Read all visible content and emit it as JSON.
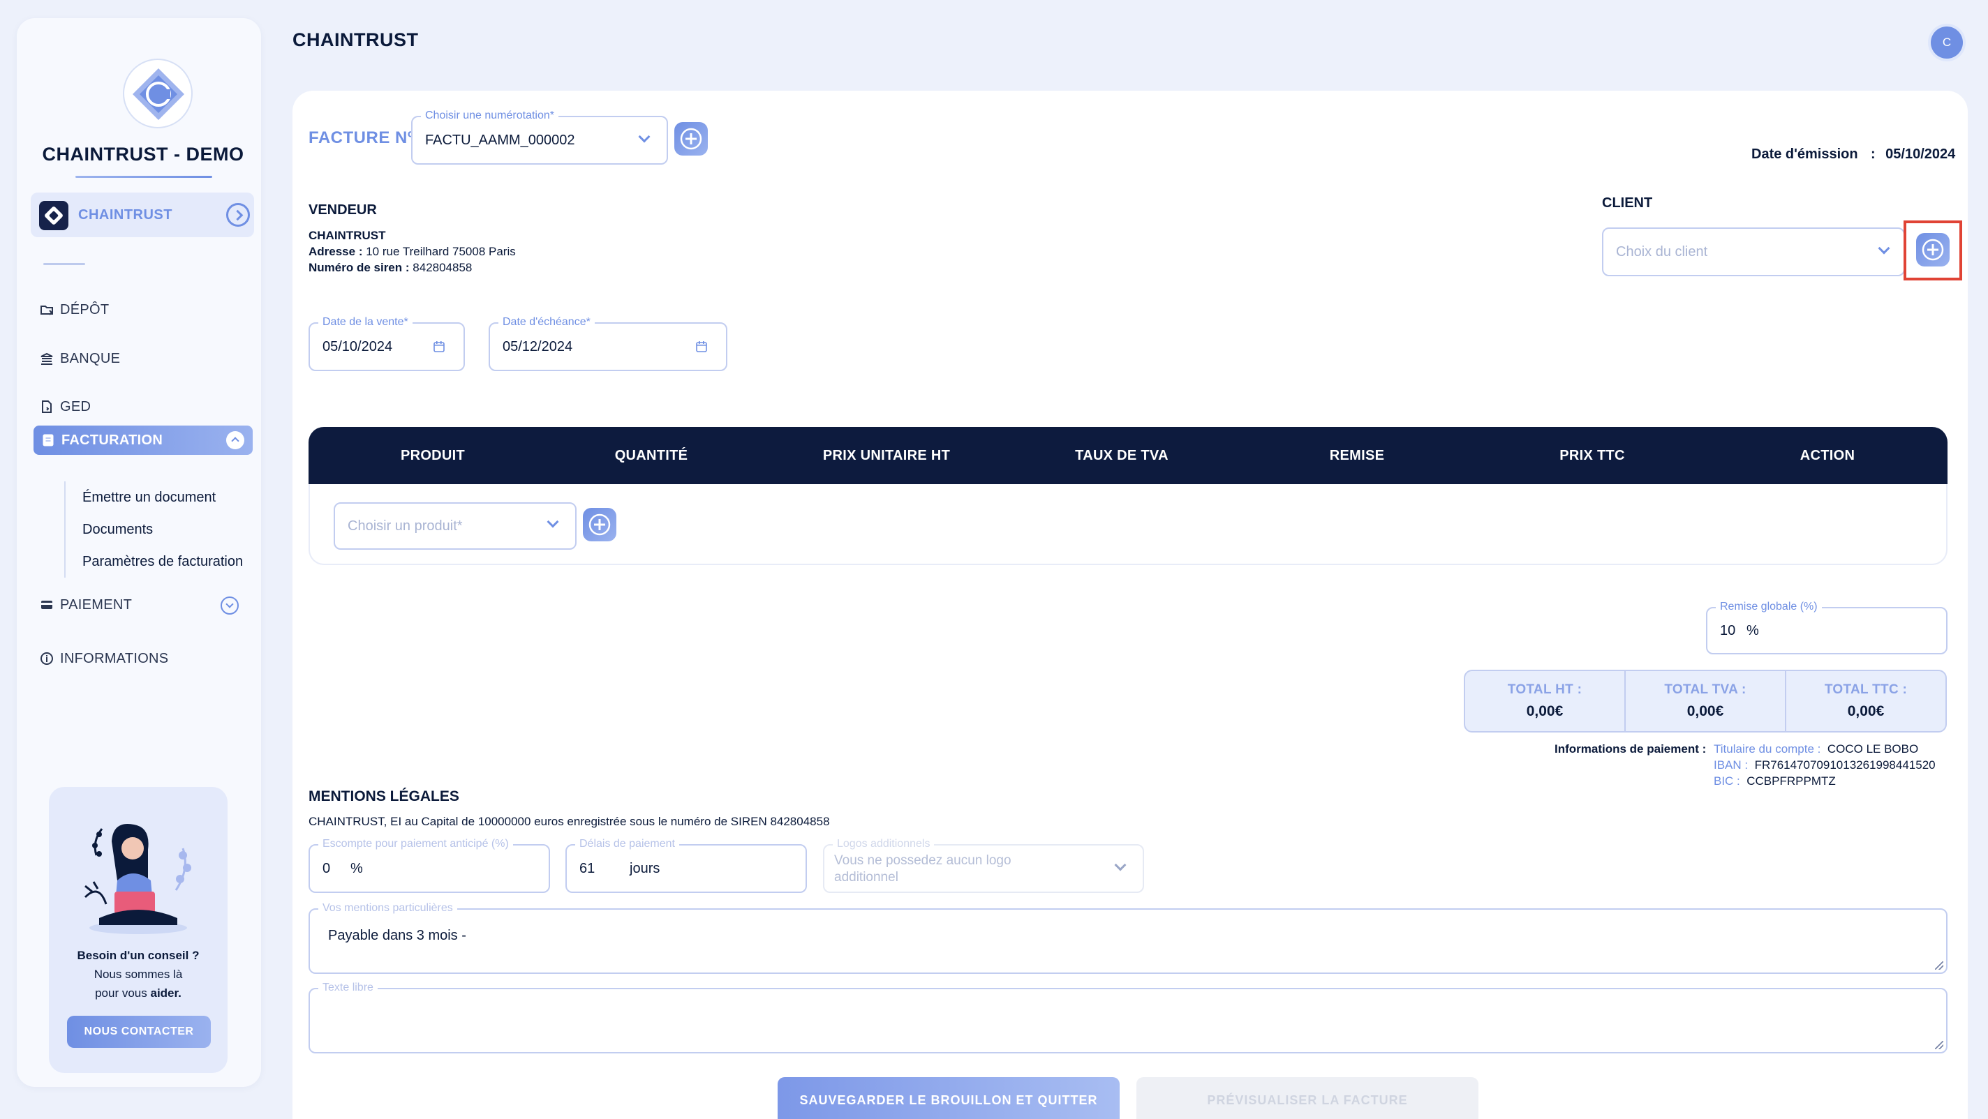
{
  "sidebar": {
    "brand_title": "CHAINTRUST - DEMO",
    "org_name": "CHAINTRUST",
    "nav": {
      "depot": "DÉPÔT",
      "banque": "BANQUE",
      "ged": "GED",
      "facturation": "FACTURATION",
      "paiement": "PAIEMENT",
      "informations": "INFORMATIONS"
    },
    "facturation_sub": [
      "Émettre un document",
      "Documents",
      "Paramètres de facturation"
    ],
    "help": {
      "line1": "Besoin d'un conseil ?",
      "line2": "Nous sommes là",
      "line3_prefix": "pour vous ",
      "line3_bold": "aider.",
      "button": "NOUS CONTACTER"
    }
  },
  "header": {
    "title": "CHAINTRUST",
    "avatar_initial": "C"
  },
  "invoice": {
    "facture_label": "FACTURE Nº",
    "numerotation": {
      "label": "Choisir une numérotation*",
      "value": "FACTU_AAMM_000002"
    },
    "date_emission_label": "Date d'émission",
    "date_emission_sep": ":",
    "date_emission_value": "05/10/2024",
    "vendeur": {
      "heading": "VENDEUR",
      "name": "CHAINTRUST",
      "adresse_label": "Adresse :",
      "adresse_value": "10 rue Treilhard 75008 Paris",
      "siren_label": "Numéro de siren :",
      "siren_value": "842804858"
    },
    "client": {
      "heading": "CLIENT",
      "placeholder": "Choix du client"
    },
    "date_vente": {
      "label": "Date de la vente*",
      "value": "05/10/2024"
    },
    "date_echeance": {
      "label": "Date d'échéance*",
      "value": "05/12/2024"
    },
    "table": {
      "columns": [
        "PRODUIT",
        "QUANTITÉ",
        "PRIX UNITAIRE HT",
        "TAUX DE TVA",
        "REMISE",
        "PRIX TTC",
        "ACTION"
      ],
      "product_placeholder": "Choisir un produit*"
    },
    "remise_globale": {
      "label": "Remise globale (%)",
      "value": "10",
      "unit": "%"
    },
    "totals": [
      {
        "label": "TOTAL HT :",
        "value": "0,00€"
      },
      {
        "label": "TOTAL TVA :",
        "value": "0,00€"
      },
      {
        "label": "TOTAL TTC :",
        "value": "0,00€"
      }
    ],
    "payment": {
      "heading": "Informations de paiement :",
      "titulaire_label": "Titulaire du compte :",
      "titulaire_value": "COCO LE BOBO",
      "iban_label": "IBAN :",
      "iban_value": "FR7614707091013261998441520",
      "bic_label": "BIC :",
      "bic_value": "CCBPFRPPMTZ"
    },
    "mentions": {
      "heading": "MENTIONS LÉGALES",
      "text": "CHAINTRUST, EI au Capital de 10000000 euros enregistrée sous le numéro de SIREN 842804858",
      "escompte": {
        "label": "Escompte pour paiement anticipé (%)",
        "value": "0",
        "unit": "%"
      },
      "delais": {
        "label": "Délais de paiement",
        "value": "61",
        "unit": "jours"
      },
      "logos": {
        "label": "Logos additionnels",
        "placeholder": "Vous ne possedez aucun logo additionnel"
      },
      "particulieres": {
        "label": "Vos mentions particulières",
        "value": "Payable dans 3 mois -"
      },
      "texte_libre": {
        "label": "Texte libre",
        "value": ""
      }
    },
    "buttons": {
      "save": "SAUVEGARDER LE BROUILLON ET QUITTER",
      "preview": "PRÉVISUALISER LA FACTURE"
    }
  },
  "colors": {
    "accent": "#6f8fe3",
    "navy": "#0d1b3e",
    "background": "#edf1fb",
    "highlight": "#e04335"
  }
}
